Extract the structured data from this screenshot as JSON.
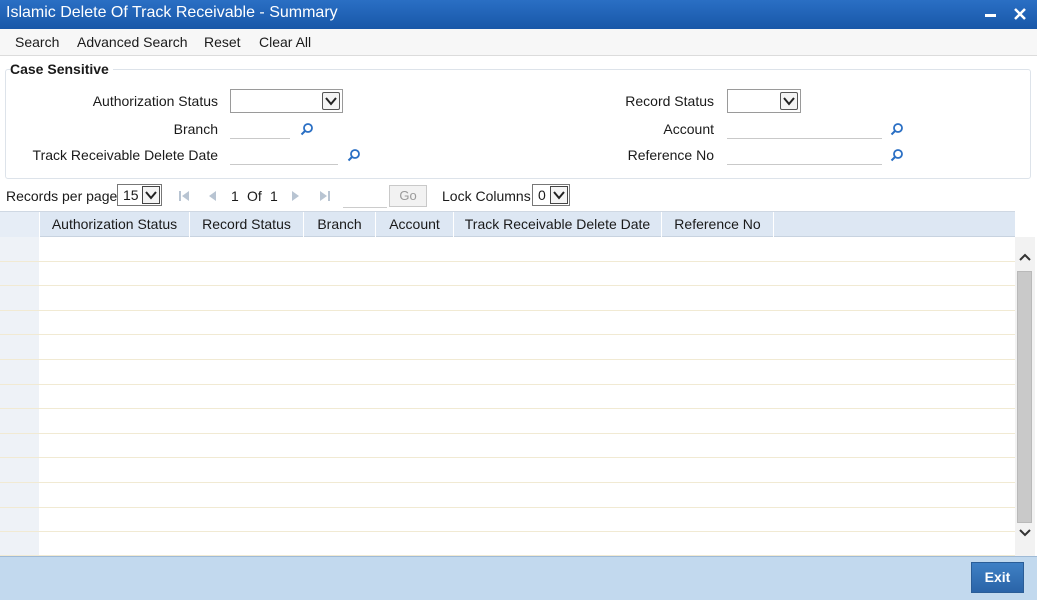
{
  "window": {
    "title": "Islamic Delete Of Track Receivable - Summary",
    "minimize_label": "−",
    "close_label": "✕"
  },
  "toolbar": {
    "search": "Search",
    "advanced_search": "Advanced Search",
    "reset": "Reset",
    "clear_all": "Clear All"
  },
  "criteria": {
    "case_sensitive": "Case Sensitive",
    "authorization_status_label": "Authorization Status",
    "authorization_status_value": "",
    "record_status_label": "Record Status",
    "record_status_value": "",
    "branch_label": "Branch",
    "branch_value": "",
    "account_label": "Account",
    "account_value": "",
    "delete_date_label": "Track Receivable Delete Date",
    "delete_date_value": "",
    "reference_no_label": "Reference No",
    "reference_no_value": ""
  },
  "pager": {
    "records_per_page_label": "Records per page",
    "records_per_page_value": "15",
    "current_page": "1",
    "of_label": "Of",
    "total_pages": "1",
    "go_label": "Go",
    "lock_columns_label": "Lock Columns",
    "lock_columns_value": "0"
  },
  "grid": {
    "columns": [
      "Authorization Status",
      "Record Status",
      "Branch",
      "Account",
      "Track Receivable Delete Date",
      "Reference No"
    ],
    "rows": []
  },
  "footer": {
    "exit_label": "Exit"
  },
  "icons": {
    "lookup": "magnifier-icon",
    "dropdown": "chevron-down-icon"
  }
}
